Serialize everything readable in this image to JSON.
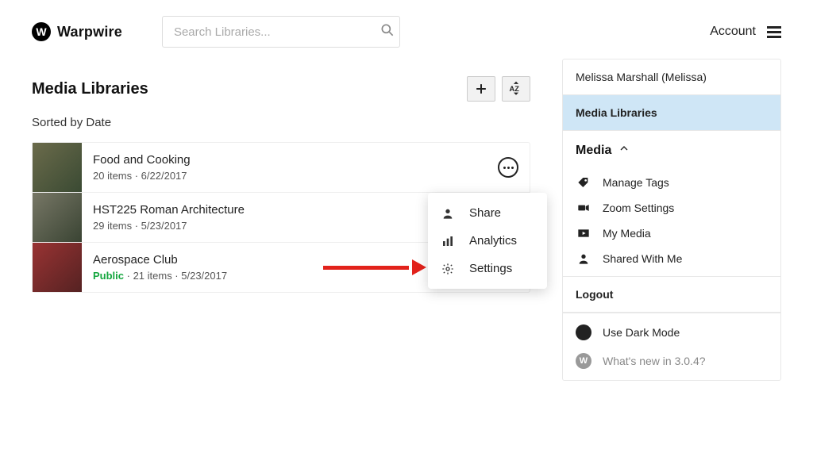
{
  "header": {
    "brand": "Warpwire",
    "logo_letter": "W",
    "search_placeholder": "Search Libraries...",
    "account_label": "Account"
  },
  "main": {
    "title": "Media Libraries",
    "sort_label": "Sorted by Date",
    "libraries": [
      {
        "title": "Food and Cooking",
        "meta": "20 items · 6/22/2017",
        "public": false
      },
      {
        "title": "HST225 Roman Architecture",
        "meta": "29 items · 5/23/2017",
        "public": false
      },
      {
        "title": "Aerospace Club",
        "meta_prefix": "Public",
        "meta_rest": " · 21 items · 5/23/2017",
        "public": true
      }
    ],
    "popup": {
      "share": "Share",
      "analytics": "Analytics",
      "settings": "Settings"
    }
  },
  "sidebar": {
    "user": "Melissa Marshall (Melissa)",
    "selected": "Media Libraries",
    "media_head": "Media",
    "items": {
      "manage_tags": "Manage Tags",
      "zoom_settings": "Zoom Settings",
      "my_media": "My Media",
      "shared_with_me": "Shared With Me"
    },
    "logout": "Logout",
    "dark_mode": "Use Dark Mode",
    "whats_new": "What's new in 3.0.4?"
  }
}
